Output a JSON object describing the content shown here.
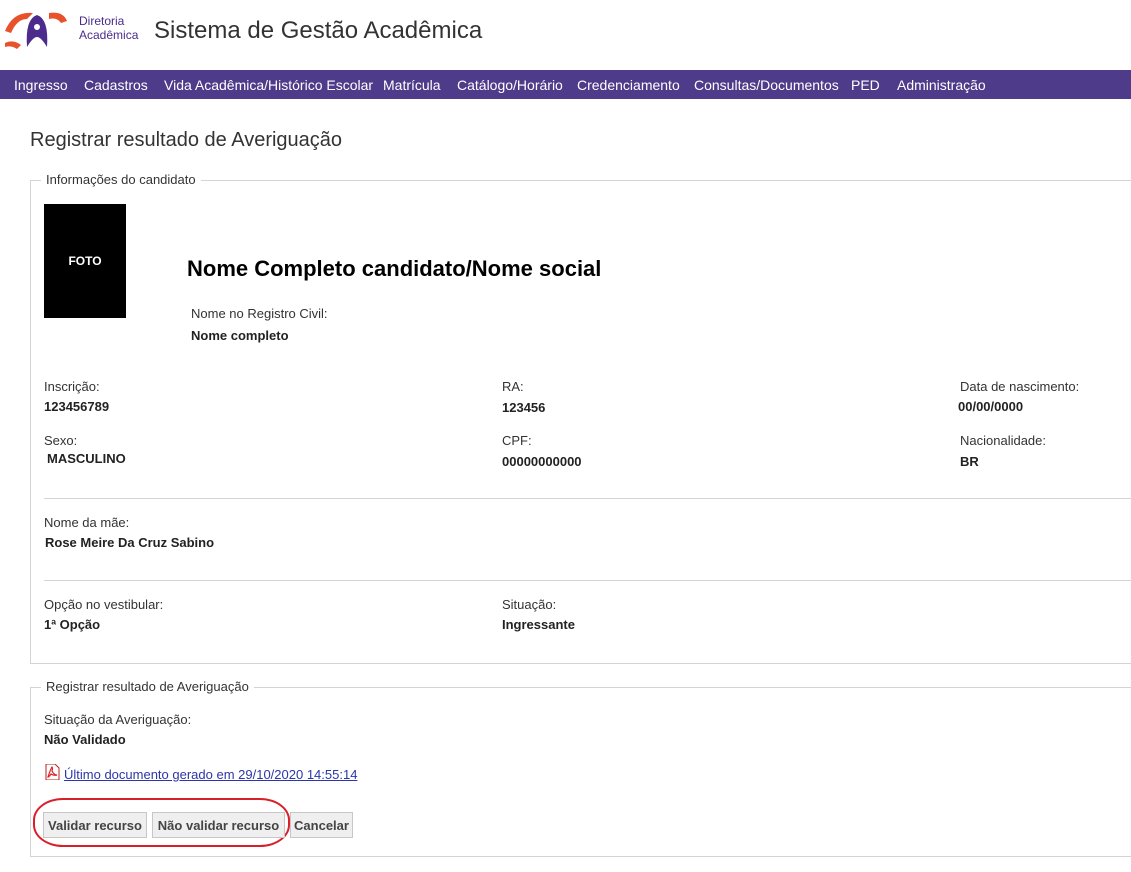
{
  "header": {
    "brand_line1": "Diretoria",
    "brand_line2": "Acadêmica",
    "system_title": "Sistema de Gestão Acadêmica"
  },
  "menu": [
    "Ingresso",
    "Cadastros",
    "Vida Acadêmica/Histórico Escolar",
    "Matrícula",
    "Catálogo/Horário",
    "Credenciamento",
    "Consultas/Documentos",
    "PED",
    "Administração"
  ],
  "page_title": "Registrar resultado de Averiguação",
  "candidate": {
    "legend": "Informações do candidato",
    "photo_label": "FOTO",
    "full_name": "Nome Completo candidato/Nome social",
    "civil_name_label": "Nome no Registro Civil:",
    "civil_name": "Nome completo",
    "inscricao_label": "Inscrição:",
    "inscricao": "123456789",
    "ra_label": "RA:",
    "ra": "123456",
    "birth_label": "Data de nascimento:",
    "birth": "00/00/0000",
    "sexo_label": "Sexo:",
    "sexo": "MASCULINO",
    "cpf_label": "CPF:",
    "cpf": "00000000000",
    "nacionalidade_label": "Nacionalidade:",
    "nacionalidade": "BR",
    "mae_label": "Nome da mãe:",
    "mae": "Rose Meire Da Cruz Sabino",
    "opcao_label": "Opção no vestibular:",
    "opcao": "1ª Opção",
    "situacao_label": "Situação:",
    "situacao": "Ingressante"
  },
  "result": {
    "legend": "Registrar resultado de Averiguação",
    "situacao_label": "Situação da Averiguação:",
    "situacao": "Não Validado",
    "document_link": "Último documento gerado em 29/10/2020 14:55:14"
  },
  "buttons": {
    "validate": "Validar recurso",
    "not_validate": "Não validar recurso",
    "cancel": "Cancelar"
  },
  "colors": {
    "menu_bg": "#4e3b8a",
    "brand": "#4b2b8c",
    "logo_orange": "#e8522a",
    "highlight": "#d8202a",
    "link": "#2b36a8"
  },
  "icons": [
    "logo-icon",
    "pdf-icon"
  ]
}
